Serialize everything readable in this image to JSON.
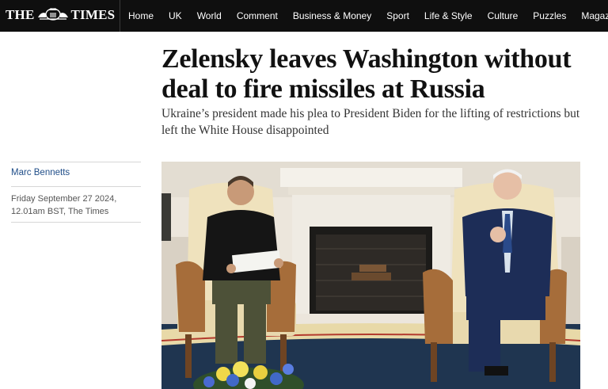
{
  "masthead": {
    "brand_left": "THE",
    "brand_right": "TIMES",
    "crest_icon": "royal-crest-icon"
  },
  "nav": {
    "items": [
      "Home",
      "UK",
      "World",
      "Comment",
      "Business & Money",
      "Sport",
      "Life & Style",
      "Culture",
      "Puzzles",
      "Magazines"
    ]
  },
  "article": {
    "headline": "Zelensky leaves Washington without deal to fire missiles at Russia",
    "standfirst": "Ukraine’s president made his plea to President Biden for the lifting of restrictions but left the White House disappointed",
    "author": "Marc Bennetts",
    "date_line1": "Friday September 27 2024,",
    "date_line2": "12.01am BST, The Times"
  },
  "colors": {
    "nav_background": "#0f0f0f",
    "author_link": "#1f4d88",
    "headline": "#111111"
  }
}
